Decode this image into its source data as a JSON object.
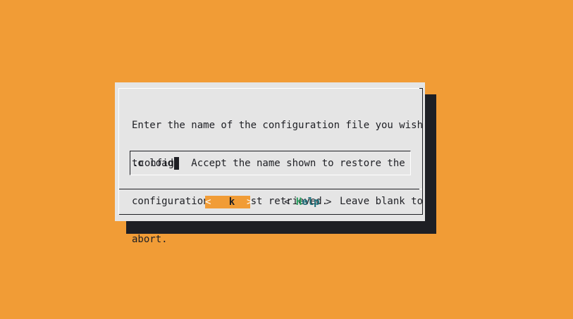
{
  "dialog": {
    "prompt_lines": [
      "Enter the name of the configuration file you wish",
      "to load.  Accept the name shown to restore the",
      "configuration you last retrieved.  Leave blank to",
      "abort."
    ],
    "input": {
      "value": ".config"
    },
    "buttons": {
      "ok": {
        "left_bracket": "<",
        "hotkey_prefix": " ",
        "label": "k",
        "right_bracket": ">"
      },
      "help": {
        "left_bracket": "<",
        "hotkey": "H",
        "label_rest": "elp",
        "right_bracket": ">"
      }
    }
  },
  "colors": {
    "background": "#f19c36",
    "dialog": "#e5e5e5",
    "shadow": "#1e1f24",
    "ok_button_bg": "#f19c36",
    "help_hotkey": "#2aa060",
    "help_label": "#1b6f7a"
  }
}
